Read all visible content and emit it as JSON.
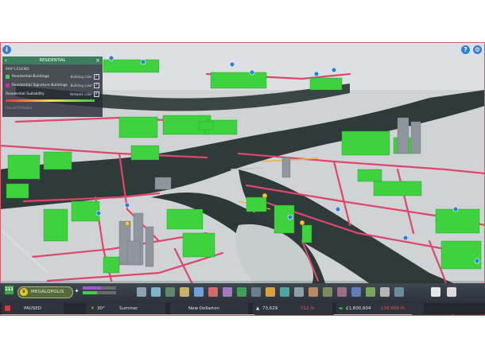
{
  "top_left_button": {
    "glyph": "i",
    "icon": "info-icon"
  },
  "top_right_buttons": [
    {
      "glyph": "?",
      "icon": "help-icon"
    },
    {
      "glyph": "⚙",
      "icon": "gear-icon"
    }
  ],
  "legend": {
    "title": "RESIDENTIAL",
    "section": "MAP LEGEND",
    "rows": [
      {
        "label": "Residential Buildings",
        "note": "Building color",
        "color": "#3ed23e",
        "checked": true
      },
      {
        "label": "Residential Signature Buildings",
        "note": "Building color",
        "color": "#e41fb0",
        "checked": true
      },
      {
        "label": "Residential Suitability",
        "note": "Network color",
        "color": "#3ed23e",
        "checked": true
      }
    ],
    "faded_label": "Ground Pollution"
  },
  "toolbar": {
    "milestone_badge": "111",
    "city_tier": "MEGALOPOLIS",
    "progress": {
      "purple": 0.55,
      "green": 0.42
    }
  },
  "status": {
    "state": "PAUSED",
    "temperature": "30°",
    "season": "Summer",
    "city_name": "New Dollarton",
    "population": "73,629",
    "population_change": "-712 /h",
    "money": "₵1,600,604",
    "money_change": "-138,699 /h"
  },
  "colors": {
    "residential": "#3ed23e",
    "roads": "#e0456a",
    "water": "#2c3938",
    "frame": "#d85a68"
  }
}
